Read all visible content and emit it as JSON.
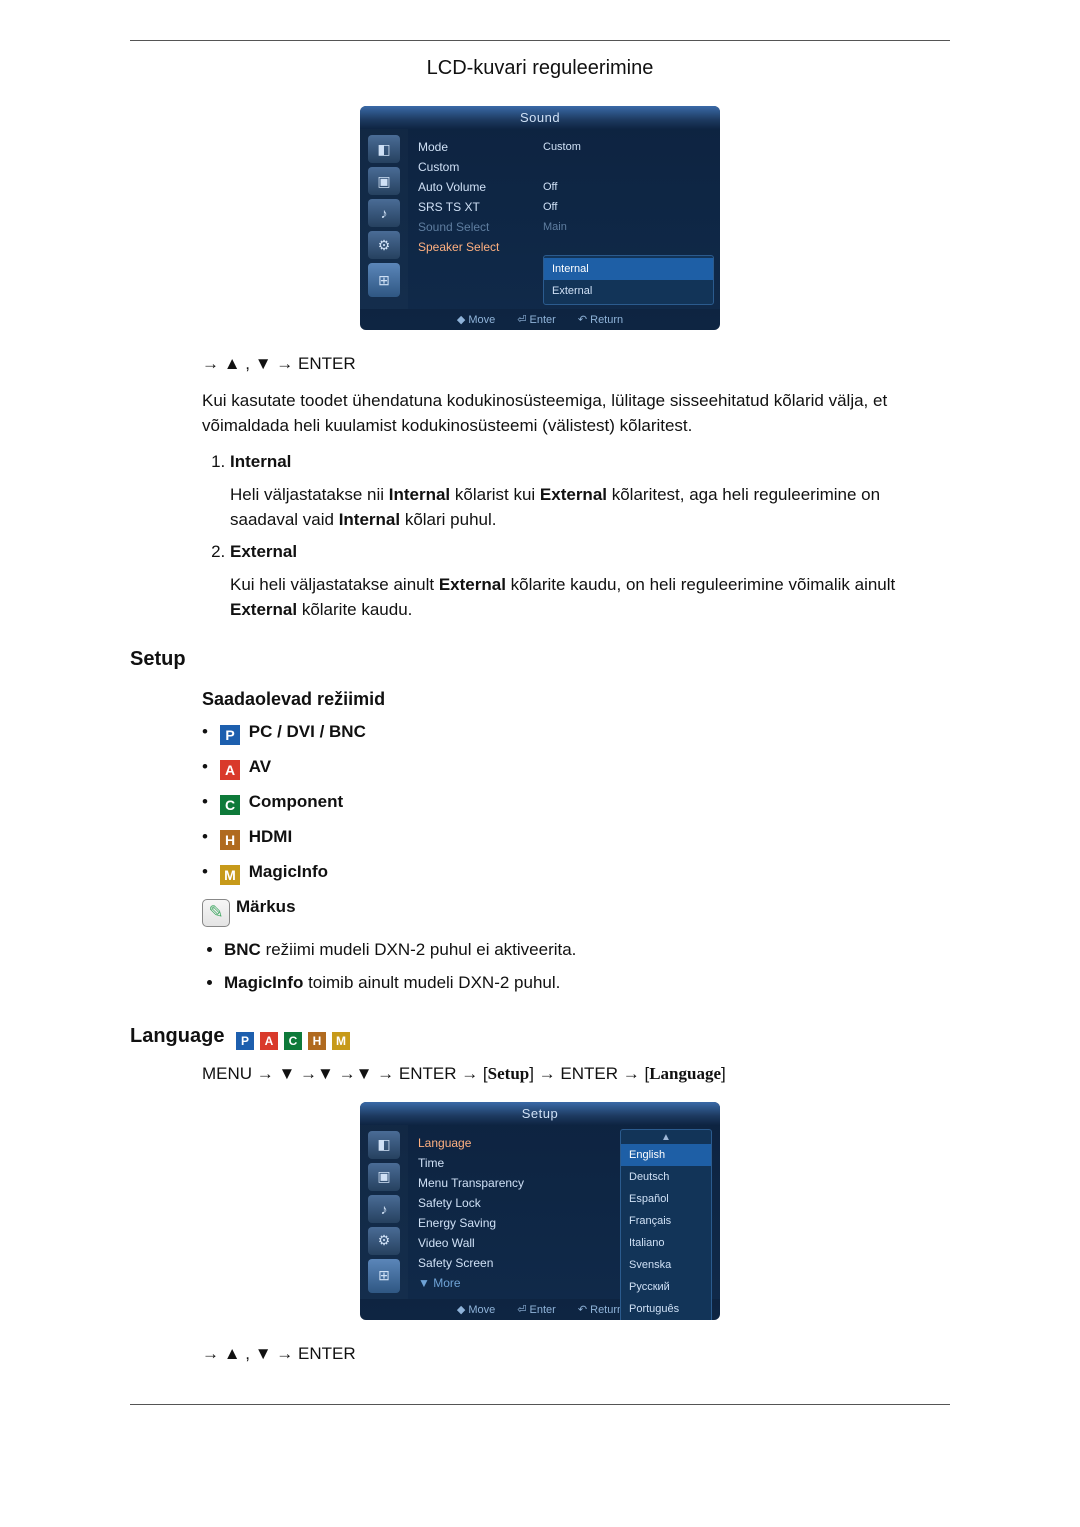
{
  "page_header": "LCD-kuvari reguleerimine",
  "osd_sound": {
    "title": "Sound",
    "icons": [
      "picture",
      "input",
      "sound",
      "setup",
      "multi"
    ],
    "items": [
      {
        "label": "Mode",
        "value": "Custom"
      },
      {
        "label": "Custom",
        "value": ""
      },
      {
        "label": "Auto Volume",
        "value": "Off"
      },
      {
        "label": "SRS TS XT",
        "value": "Off"
      },
      {
        "label": "Sound Select",
        "value": "Main",
        "dim": true
      },
      {
        "label": "Speaker Select",
        "value": "",
        "highlight": true
      }
    ],
    "dropdown": {
      "selected": "Internal",
      "other": "External"
    },
    "footer": {
      "move": "Move",
      "enter": "Enter",
      "return": "Return"
    }
  },
  "nav1": "→ ▲ , ▼ → ENTER",
  "intro": "Kui kasutate toodet ühendatuna kodukinosüsteemiga, lülitage sisseehitatud kõlarid välja, et võimaldada heli kuulamist kodukinosüsteemi (välistest) kõlaritest.",
  "list": [
    {
      "title": "Internal",
      "desc_pre": "Heli väljastatakse nii ",
      "b1": "Internal",
      "mid1": " kõlarist kui ",
      "b2": "External",
      "mid2": " kõlaritest, aga heli reguleerimine on saadaval vaid ",
      "b3": "Internal",
      "post": " kõlari puhul."
    },
    {
      "title": "External",
      "desc_pre": "Kui heli väljastatakse ainult ",
      "b1": "External",
      "mid1": " kõlarite kaudu, on heli reguleerimine võimalik ainult ",
      "b2": "External",
      "post": " kõlarite kaudu."
    }
  ],
  "setup_heading": "Setup",
  "modes_heading": "Saadaolevad režiimid",
  "modes": [
    {
      "badge": "P",
      "label": "PC / DVI / BNC"
    },
    {
      "badge": "A",
      "label": "AV"
    },
    {
      "badge": "C",
      "label": "Component"
    },
    {
      "badge": "H",
      "label": "HDMI"
    },
    {
      "badge": "M",
      "label": "MagicInfo"
    }
  ],
  "note_label": "Märkus",
  "notes": [
    {
      "b": "BNC",
      "txt": " režiimi mudeli DXN-2 puhul ei aktiveerita."
    },
    {
      "b": "MagicInfo",
      "txt": " toimib ainult mudeli DXN-2 puhul."
    }
  ],
  "lang_heading": "Language",
  "lang_nav": {
    "pre": "MENU → ▼ →▼ →▼ → ENTER → [",
    "setup": "Setup",
    "mid": "] → ENTER → [",
    "lang": "Language",
    "post": "]"
  },
  "osd_setup": {
    "title": "Setup",
    "icons": [
      "picture",
      "input",
      "sound",
      "setup",
      "multi"
    ],
    "items": [
      {
        "label": "Language",
        "highlight": true
      },
      {
        "label": "Time"
      },
      {
        "label": "Menu Transparency"
      },
      {
        "label": "Safety Lock"
      },
      {
        "label": "Energy Saving"
      },
      {
        "label": "Video Wall"
      },
      {
        "label": "Safety Screen"
      },
      {
        "label": "▼ More",
        "more": true
      }
    ],
    "langs": [
      "English",
      "Deutsch",
      "Español",
      "Français",
      "Italiano",
      "Svenska",
      "Русский",
      "Português"
    ],
    "lang_selected": "English",
    "footer": {
      "move": "Move",
      "enter": "Enter",
      "return": "Return"
    }
  },
  "nav2": "→ ▲ , ▼ → ENTER"
}
